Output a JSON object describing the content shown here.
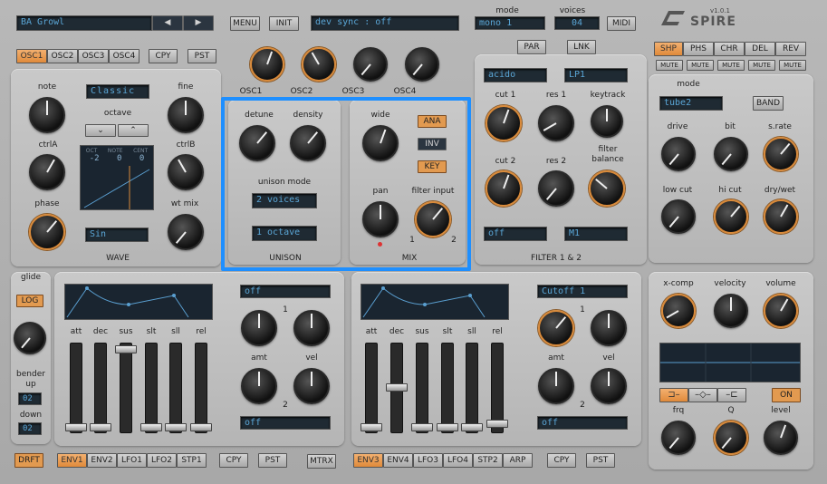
{
  "top": {
    "preset": "BA Growl",
    "menu": "MENU",
    "init": "INIT",
    "sync_label": "dev sync",
    "sync_value": "off",
    "mode_label": "mode",
    "mode_value": "mono 1",
    "voices_label": "voices",
    "voices_value": "04",
    "midi": "MIDI",
    "logo": "SPIRE",
    "version": "v1.0.1"
  },
  "osc_tabs": [
    "OSC1",
    "OSC2",
    "OSC3",
    "OSC4"
  ],
  "cpy": "CPY",
  "pst": "PST",
  "osc_knob_labels": [
    "OSC1",
    "OSC2",
    "OSC3",
    "OSC4"
  ],
  "osc": {
    "note": "note",
    "mode": "Classic",
    "fine": "fine",
    "octave": "octave",
    "ctrlA": "ctrlA",
    "ctrlB": "ctrlB",
    "phase": "phase",
    "wtmix": "wt mix",
    "wave": "Sin",
    "wave_label": "WAVE",
    "readout": {
      "h1": "OCT",
      "h2": "NOTE",
      "h3": "CENT",
      "v1": "-2",
      "v2": "0",
      "v3": "0"
    }
  },
  "unison": {
    "detune": "detune",
    "density": "density",
    "mode_label": "unison mode",
    "voices": "2 voices",
    "octave": "1 octave",
    "title": "UNISON"
  },
  "mix": {
    "wide": "wide",
    "ana": "ANA",
    "inv": "INV",
    "key": "KEY",
    "pan": "pan",
    "filter_input": "filter input",
    "f1": "1",
    "f2": "2",
    "title": "MIX"
  },
  "filter": {
    "par": "PAR",
    "lnk": "LNK",
    "type1": "acido",
    "type2": "LP1",
    "cut1": "cut 1",
    "res1": "res 1",
    "keytrack": "keytrack",
    "cut2": "cut 2",
    "res2": "res 2",
    "balance": "filter\nbalance",
    "mode1": "off",
    "mode2": "M1",
    "title": "FILTER 1 & 2"
  },
  "fx_tabs": [
    "SHP",
    "PHS",
    "CHR",
    "DEL",
    "REV"
  ],
  "mute": "MUTE",
  "shaper": {
    "mode_label": "mode",
    "mode": "tube2",
    "band": "BAND",
    "drive": "drive",
    "bit": "bit",
    "srate": "s.rate",
    "lowcut": "low cut",
    "hicut": "hi cut",
    "drywet": "dry/wet"
  },
  "out": {
    "xcomp": "x-comp",
    "velocity": "velocity",
    "volume": "volume",
    "on": "ON",
    "frq": "frq",
    "q": "Q",
    "level": "level"
  },
  "glide": {
    "label": "glide",
    "log": "LOG",
    "bender_up": "bender\nup",
    "up_val": "02",
    "down": "down",
    "down_val": "02"
  },
  "env1": {
    "dest": "off",
    "dest2": "off",
    "one": "1",
    "two": "2",
    "amt": "amt",
    "vel": "vel",
    "faders": [
      "att",
      "dec",
      "sus",
      "slt",
      "sll",
      "rel"
    ]
  },
  "env2": {
    "dest": "Cutoff 1",
    "dest2": "off",
    "one": "1",
    "two": "2",
    "amt": "amt",
    "vel": "vel",
    "faders": [
      "att",
      "dec",
      "sus",
      "slt",
      "sll",
      "rel"
    ]
  },
  "bottom": {
    "drft": "DRFT",
    "tabs1": [
      "ENV1",
      "ENV2",
      "LFO1",
      "LFO2",
      "STP1"
    ],
    "cpy": "CPY",
    "pst": "PST",
    "mtrx": "MTRX",
    "tabs2": [
      "ENV3",
      "ENV4",
      "LFO3",
      "LFO4",
      "STP2",
      "ARP"
    ]
  }
}
